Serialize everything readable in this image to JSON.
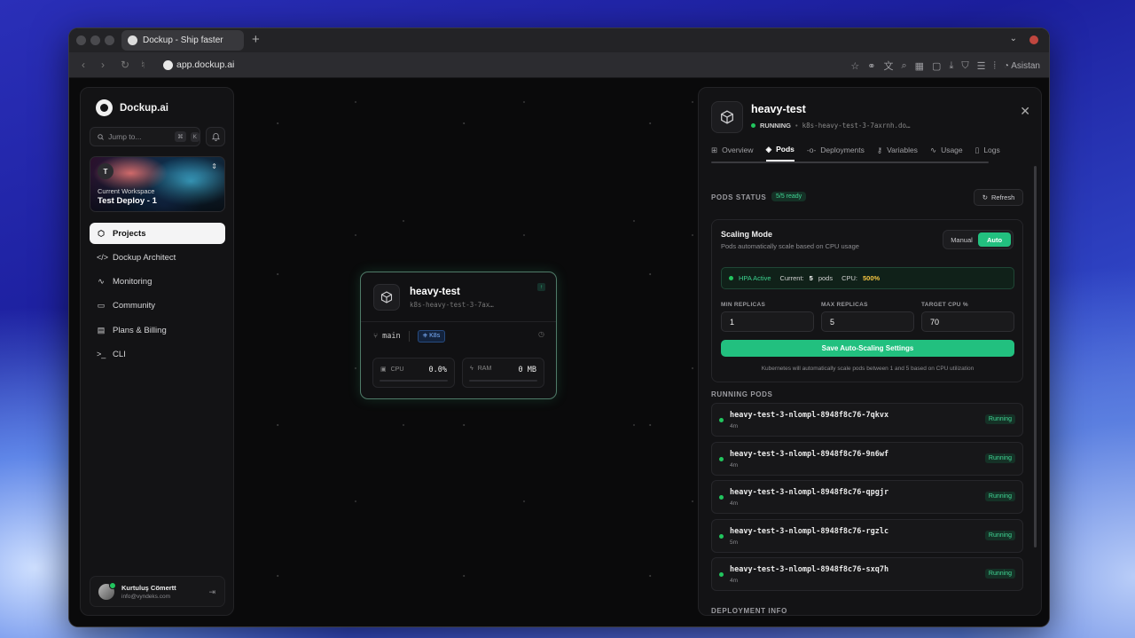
{
  "browser": {
    "tab_title": "Dockup - Ship faster",
    "url": "app.dockup.ai",
    "assistant_label": "Asistan"
  },
  "brand": {
    "name": "Dockup.ai"
  },
  "search": {
    "placeholder": "Jump to...",
    "shortcut_1": "⌘",
    "shortcut_2": "K"
  },
  "workspace": {
    "avatar": "T",
    "label": "Current Workspace",
    "name": "Test Deploy - 1"
  },
  "nav": [
    {
      "label": "Projects",
      "icon": "cube-icon"
    },
    {
      "label": "Dockup Architect",
      "icon": "code-icon"
    },
    {
      "label": "Monitoring",
      "icon": "activity-icon"
    },
    {
      "label": "Community",
      "icon": "message-icon"
    },
    {
      "label": "Plans & Billing",
      "icon": "card-icon"
    },
    {
      "label": "CLI",
      "icon": "terminal-icon"
    }
  ],
  "user": {
    "name": "Kurtuluş Cömertt",
    "email": "info@vyndeks.com"
  },
  "node": {
    "title": "heavy-test",
    "subtitle": "k8s-heavy-test-3-7ax…",
    "branch": "main",
    "platform": "K8s",
    "cpu_label": "CPU",
    "cpu_value": "0.0%",
    "ram_label": "RAM",
    "ram_value": "0 MB"
  },
  "panel": {
    "title": "heavy-test",
    "status": "RUNNING",
    "host": "k8s-heavy-test-3-7axrnh.do…",
    "tabs": [
      {
        "label": "Overview",
        "icon": "grid-icon"
      },
      {
        "label": "Pods",
        "icon": "layers-icon"
      },
      {
        "label": "Deployments",
        "icon": "commit-icon"
      },
      {
        "label": "Variables",
        "icon": "key-icon"
      },
      {
        "label": "Usage",
        "icon": "activity-icon"
      },
      {
        "label": "Logs",
        "icon": "file-icon"
      }
    ],
    "active_tab": "Pods",
    "pods_status_heading": "PODS STATUS",
    "ready_badge": "5/5 ready",
    "refresh_label": "Refresh",
    "scaling": {
      "title": "Scaling Mode",
      "description": "Pods automatically scale based on CPU usage",
      "manual_label": "Manual",
      "auto_label": "Auto",
      "hpa_label": "HPA Active",
      "current_label": "Current:",
      "current_value": "5",
      "current_unit": "pods",
      "cpu_label": "CPU:",
      "cpu_value": "500%",
      "min_label": "MIN REPLICAS",
      "min_value": "1",
      "max_label": "MAX REPLICAS",
      "max_value": "5",
      "target_label": "TARGET CPU %",
      "target_value": "70",
      "save_label": "Save Auto-Scaling Settings",
      "note": "Kubernetes will automatically scale pods between 1 and 5 based on CPU utilization"
    },
    "running_pods_heading": "RUNNING PODS",
    "pods": [
      {
        "name": "heavy-test-3-nlompl-8948f8c76-7qkvx",
        "age": "4m",
        "status": "Running"
      },
      {
        "name": "heavy-test-3-nlompl-8948f8c76-9n6wf",
        "age": "4m",
        "status": "Running"
      },
      {
        "name": "heavy-test-3-nlompl-8948f8c76-qpgjr",
        "age": "4m",
        "status": "Running"
      },
      {
        "name": "heavy-test-3-nlompl-8948f8c76-rgzlc",
        "age": "5m",
        "status": "Running"
      },
      {
        "name": "heavy-test-3-nlompl-8948f8c76-sxq7h",
        "age": "4m",
        "status": "Running"
      }
    ],
    "deployment_info_heading": "DEPLOYMENT INFO"
  },
  "colors": {
    "accent": "#22c07f",
    "status_green": "#22c55e",
    "cpu_highlight": "#f5c542",
    "k8s_blue": "#7eb2ff"
  }
}
